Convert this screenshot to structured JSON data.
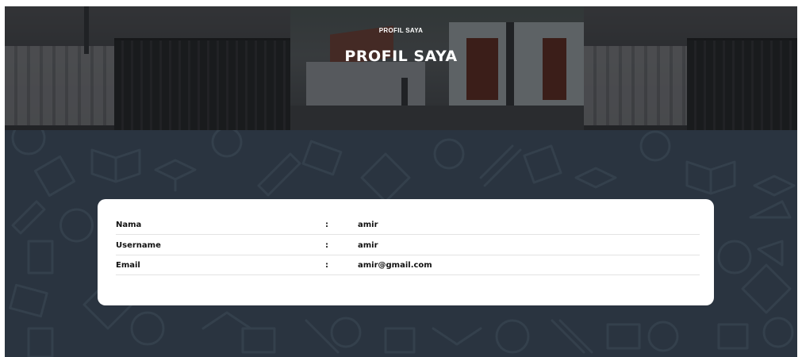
{
  "hero": {
    "subtitle": "PROFIL SAYA",
    "title": "PROFIL SAYA"
  },
  "profile": {
    "rows": [
      {
        "label": "Nama",
        "separator": ":",
        "value": "amir"
      },
      {
        "label": "Username",
        "separator": ":",
        "value": "amir"
      },
      {
        "label": "Email",
        "separator": ":",
        "value": "amir@gmail.com"
      }
    ]
  },
  "colors": {
    "page_background": "#2a3440",
    "card_background": "#ffffff",
    "hero_text": "#ffffff"
  }
}
